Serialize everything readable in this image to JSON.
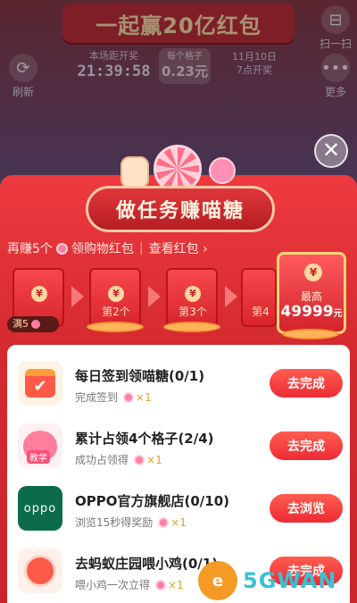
{
  "background": {
    "banner_text": "一起赢20亿红包",
    "left_button": "刷新",
    "right_top_button": "扫一扫",
    "right_button": "更多",
    "timer_label": "本场距开奖",
    "timer_value": "21:39:58",
    "per_label": "每个格子",
    "per_value": "0.23元",
    "date_text_line1": "11月10日",
    "date_text_line2": "7点开奖"
  },
  "close_icon": "close-icon",
  "panel": {
    "title": "做任务赚喵糖",
    "subline_part1": "再赚5个",
    "subline_part2": "领购物红包",
    "subline_link": "查看红包 ›"
  },
  "envelopes": [
    {
      "caption": ""
    },
    {
      "caption": "第2个"
    },
    {
      "caption": "第3个"
    },
    {
      "caption": "第4"
    }
  ],
  "full_tag": "满5",
  "big_prize": {
    "label": "最高",
    "amount": "49999",
    "unit": "元"
  },
  "tasks": [
    {
      "title": "每日签到领喵糖(0/1)",
      "subtitle": "完成签到",
      "multiplier": "×1",
      "button": "去完成",
      "icon": "calendar-check-icon"
    },
    {
      "title": "累计占领4个格子(2/4)",
      "subtitle": "成功占领得",
      "multiplier": "×1",
      "button": "去完成",
      "icon": "cat-mascot-icon"
    },
    {
      "title": "OPPO官方旗舰店(0/10)",
      "subtitle": "浏览15秒得奖励",
      "multiplier": "×1",
      "button": "去浏览",
      "icon": "oppo-logo-icon"
    },
    {
      "title": "去蚂蚁庄园喂小鸡(0/1)",
      "subtitle": "喂小鸡一次立得",
      "multiplier": "×1",
      "button": "去完成",
      "icon": "chick-icon"
    }
  ],
  "oppo_logo_text": "oppo",
  "cat_tag": "教学",
  "watermark": "5GWAN",
  "colors": {
    "panel_red": "#d42a30",
    "button_red": "#ec2b35",
    "candy_pink": "#ff7ea1",
    "oppo_green": "#0c6c4a"
  }
}
